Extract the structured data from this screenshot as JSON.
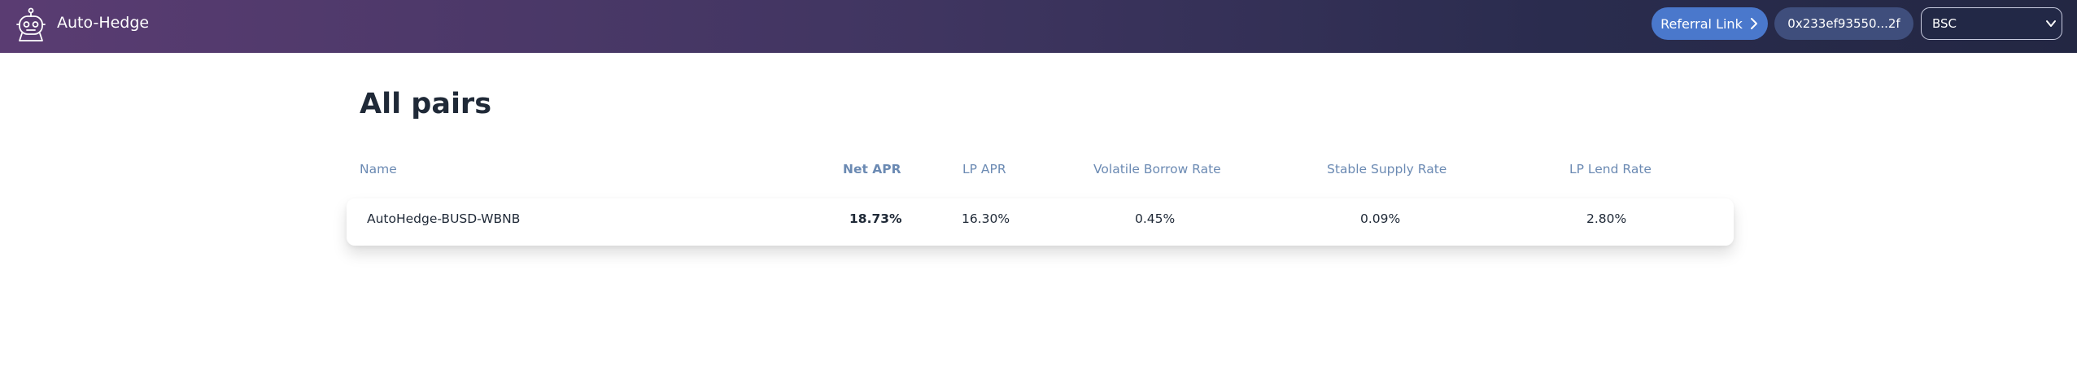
{
  "header": {
    "app_title": "Auto-Hedge",
    "logo_icon": "robot-icon",
    "referral_label": "Referral Link",
    "wallet_address": "0x233ef93550...2f",
    "network_selected": "BSC"
  },
  "main": {
    "title": "All pairs",
    "columns": [
      "Name",
      "Net APR",
      "LP APR",
      "Volatile Borrow Rate",
      "Stable Supply Rate",
      "LP Lend Rate"
    ],
    "rows": [
      {
        "name": "AutoHedge-BUSD-WBNB",
        "net_apr": "18.73%",
        "lp_apr": "16.30%",
        "volatile_borrow_rate": "0.45%",
        "stable_supply_rate": "0.09%",
        "lp_lend_rate": "2.80%"
      }
    ]
  },
  "colors": {
    "header_gradient_start": "#5a3c72",
    "header_gradient_end": "#232743",
    "referral_button": "#4a78cc",
    "wallet_button": "#3f4e7c",
    "column_header_text": "#6b8ab3"
  }
}
